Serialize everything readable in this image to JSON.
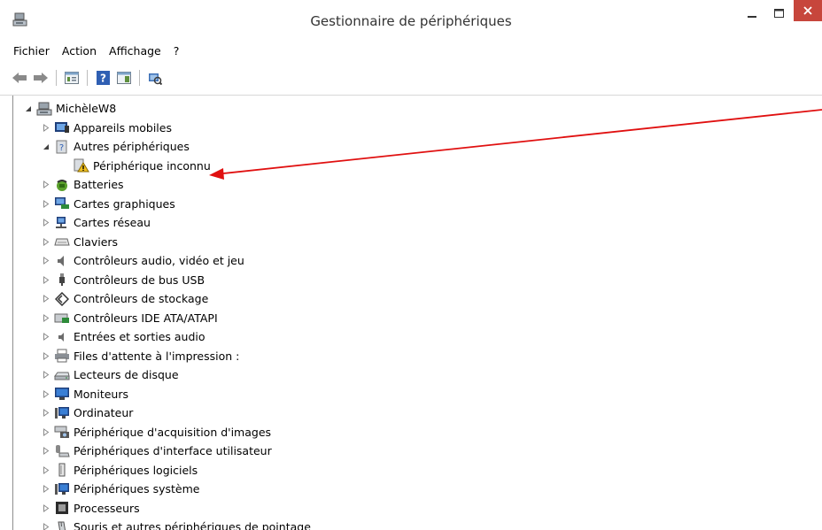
{
  "window": {
    "title": "Gestionnaire de périphériques",
    "close_color": "#c7463c"
  },
  "menu": [
    "Fichier",
    "Action",
    "Affichage",
    "?"
  ],
  "toolbar": {
    "buttons": [
      "back-arrow-icon",
      "forward-arrow-icon",
      "properties-icon",
      "help-icon",
      "show-hide-icon",
      "scan-hardware-icon"
    ]
  },
  "tree": {
    "root": "MichèleW8",
    "mobile": "Appareils mobiles",
    "other": "Autres périphériques",
    "unknown": "Périphérique inconnu",
    "batteries": "Batteries",
    "display": "Cartes graphiques",
    "network": "Cartes réseau",
    "keyboards": "Claviers",
    "sound": "Contrôleurs audio, vidéo et jeu",
    "usb": "Contrôleurs de bus USB",
    "storage": "Contrôleurs de stockage",
    "ide": "Contrôleurs IDE ATA/ATAPI",
    "audio_io": "Entrées et sorties audio",
    "print_queues": "Files d'attente à l'impression :",
    "disk": "Lecteurs de disque",
    "monitors": "Moniteurs",
    "computer": "Ordinateur",
    "imaging": "Périphérique d'acquisition d'images",
    "hid": "Périphériques d'interface utilisateur",
    "software": "Périphériques logiciels",
    "system": "Périphériques système",
    "processors": "Processeurs",
    "mice": "Souris et autres périphériques de pointage"
  },
  "annotation": {
    "arrow_color": "#e01010"
  }
}
